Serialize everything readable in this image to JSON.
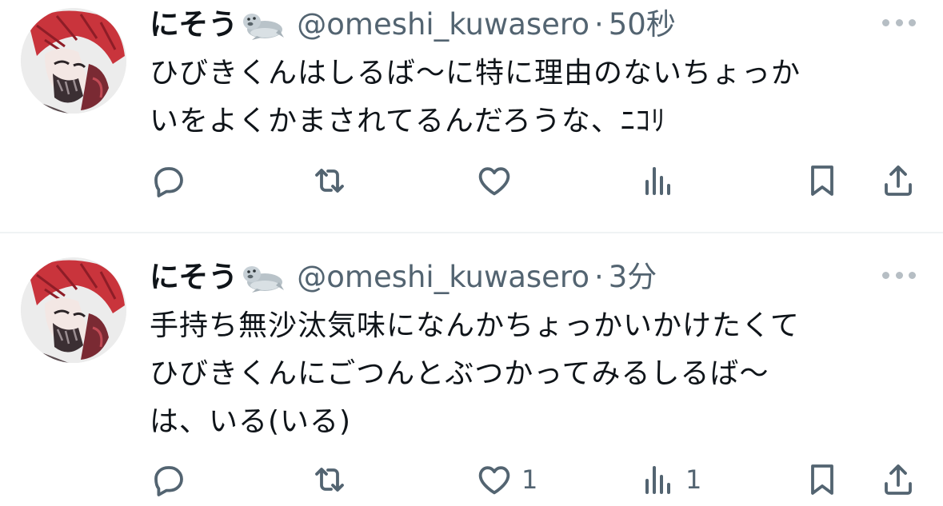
{
  "tweets": [
    {
      "author": {
        "name": "にそう",
        "emoji_icon": "seal-emoji",
        "handle": "@omeshi_kuwasero"
      },
      "separator": "·",
      "time": "50秒",
      "text_lines": [
        "ひびきくんはしるば〜に特に理由のないちょっか",
        "いをよくかまされてるんだろうな、ﾆｺﾘ"
      ],
      "actions": {
        "reply": "",
        "retweet": "",
        "like": "",
        "views": ""
      }
    },
    {
      "author": {
        "name": "にそう",
        "emoji_icon": "seal-emoji",
        "handle": "@omeshi_kuwasero"
      },
      "separator": "·",
      "time": "3分",
      "text_lines": [
        "手持ち無沙汰気味になんかちょっかいかけたくて",
        "ひびきくんにごつんとぶつかってみるしるば〜",
        "は、いる(いる)"
      ],
      "actions": {
        "reply": "",
        "retweet": "",
        "like": "1",
        "views": "1"
      }
    }
  ],
  "colors": {
    "text_primary": "#0f1419",
    "text_secondary": "#536471",
    "icon": "#536471",
    "divider": "#eff3f4",
    "avatar_hair": "#c9343c"
  },
  "icons": [
    "reply-icon",
    "retweet-icon",
    "like-icon",
    "views-icon",
    "bookmark-icon",
    "share-icon",
    "more-icon",
    "seal-emoji"
  ]
}
